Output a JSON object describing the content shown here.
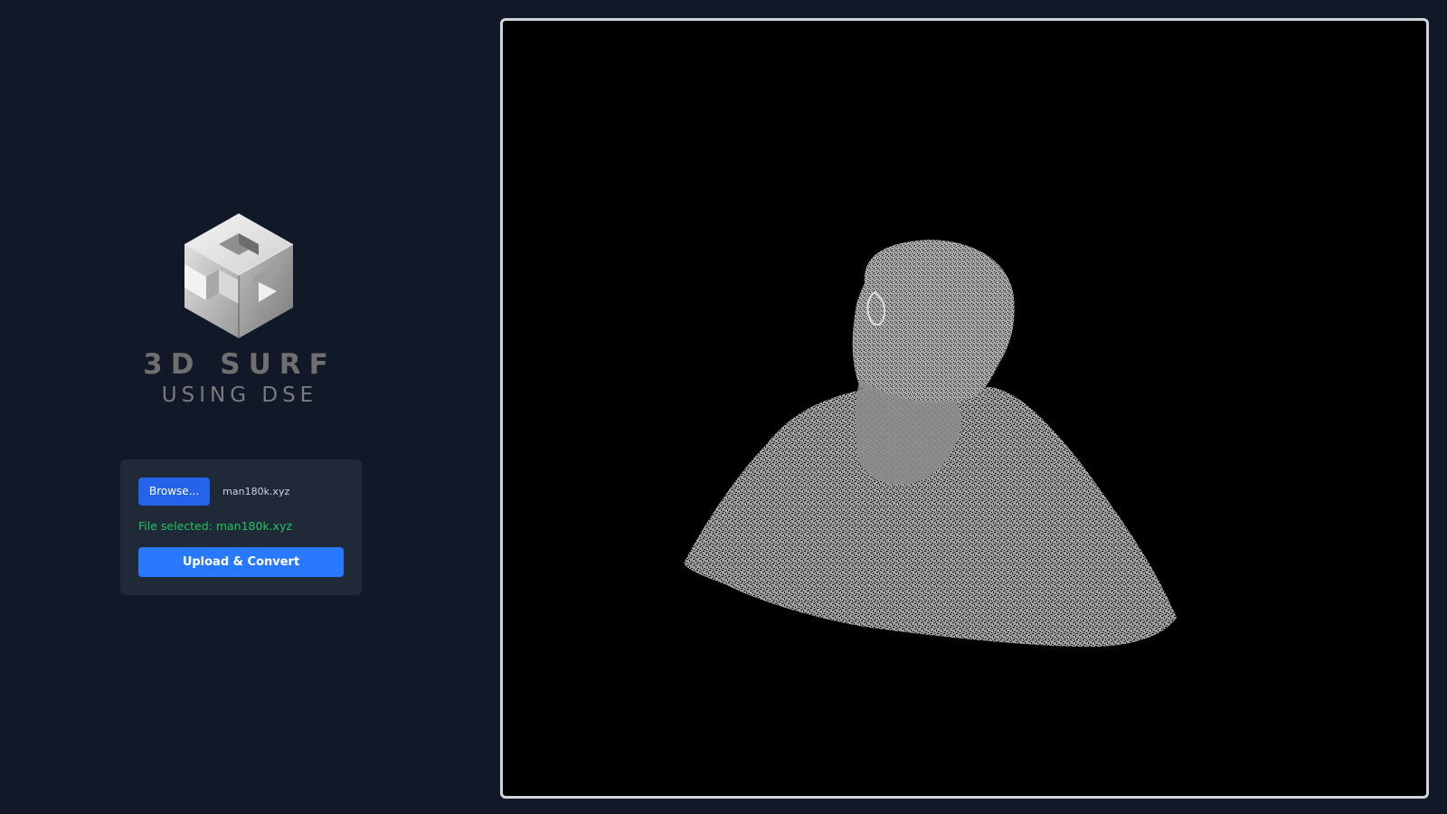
{
  "logo": {
    "title": "3D SURF",
    "subtitle": "USING DSE"
  },
  "upload": {
    "browse_label": "Browse...",
    "file_name": "man180k.xyz",
    "status_text": "File selected: man180k.xyz",
    "upload_label": "Upload & Convert"
  },
  "colors": {
    "page_background": "#111827",
    "card_background": "#1f2937",
    "browse_button": "#2563eb",
    "upload_button": "#2979ff",
    "status_success": "#22c55e",
    "viewer_background": "#000000",
    "viewer_border": "#d1d5db"
  },
  "viewer": {
    "content": "point-cloud-bust"
  }
}
